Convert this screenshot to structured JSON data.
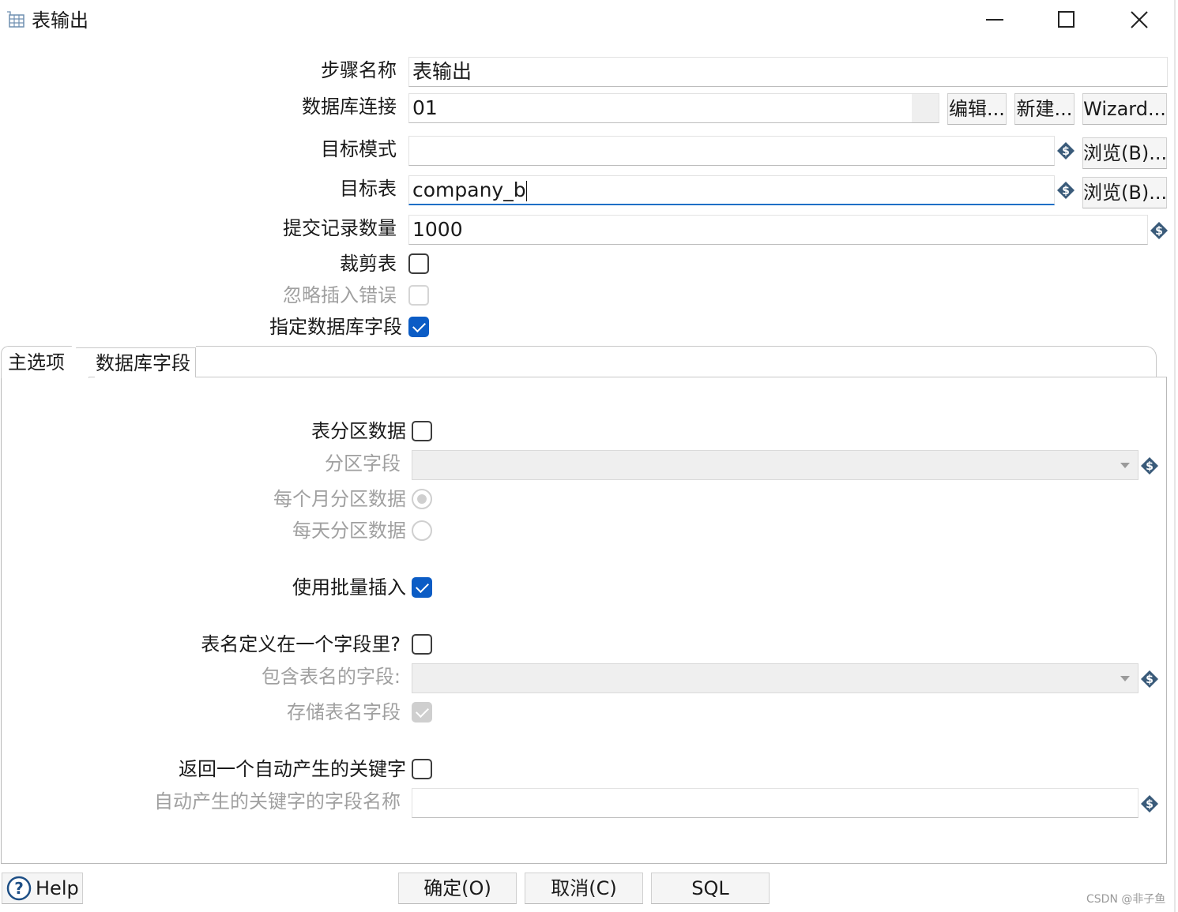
{
  "window": {
    "title": "表输出",
    "minimize_icon": "minimize-icon",
    "maximize_icon": "maximize-icon",
    "close_icon": "close-icon"
  },
  "form": {
    "step_name": {
      "label": "步骤名称",
      "value": "表输出"
    },
    "db_connection": {
      "label": "数据库连接",
      "value": "01",
      "edit_button": "编辑...",
      "new_button": "新建...",
      "wizard_button": "Wizard..."
    },
    "target_schema": {
      "label": "目标模式",
      "value": "",
      "browse_button": "浏览(B)..."
    },
    "target_table": {
      "label": "目标表",
      "value": "company_b",
      "browse_button": "浏览(B)..."
    },
    "commit_size": {
      "label": "提交记录数量",
      "value": "1000"
    },
    "truncate_table": {
      "label": "裁剪表",
      "checked": false
    },
    "ignore_insert_errors": {
      "label": "忽略插入错误",
      "checked": false,
      "enabled": false
    },
    "specify_db_fields": {
      "label": "指定数据库字段",
      "checked": true
    }
  },
  "tabs": [
    {
      "label": "主选项",
      "active": true
    },
    {
      "label": "数据库字段",
      "active": false
    }
  ],
  "main_options": {
    "partition_data": {
      "label": "表分区数据",
      "checked": false
    },
    "partition_field": {
      "label": "分区字段",
      "value": ""
    },
    "partition_monthly": {
      "label": "每个月分区数据",
      "selected": true
    },
    "partition_daily": {
      "label": "每天分区数据",
      "selected": false
    },
    "use_batch_insert": {
      "label": "使用批量插入",
      "checked": true
    },
    "table_name_in_field": {
      "label": "表名定义在一个字段里?",
      "checked": false
    },
    "table_name_field": {
      "label": "包含表名的字段:",
      "value": ""
    },
    "store_table_name_field": {
      "label": "存储表名字段",
      "checked": true,
      "enabled": false
    },
    "return_auto_key": {
      "label": "返回一个自动产生的关键字",
      "checked": false
    },
    "auto_key_field_name": {
      "label": "自动产生的关键字的字段名称",
      "value": ""
    }
  },
  "footer": {
    "help_button": "Help",
    "ok_button": "确定(O)",
    "cancel_button": "取消(C)",
    "sql_button": "SQL"
  },
  "watermark": "CSDN @非子鱼",
  "colors": {
    "accent": "#0b5cc5",
    "focus_underline": "#1f6fc6",
    "variable_icon": "#3a5b7a",
    "disabled_text": "#a0a0a0"
  }
}
